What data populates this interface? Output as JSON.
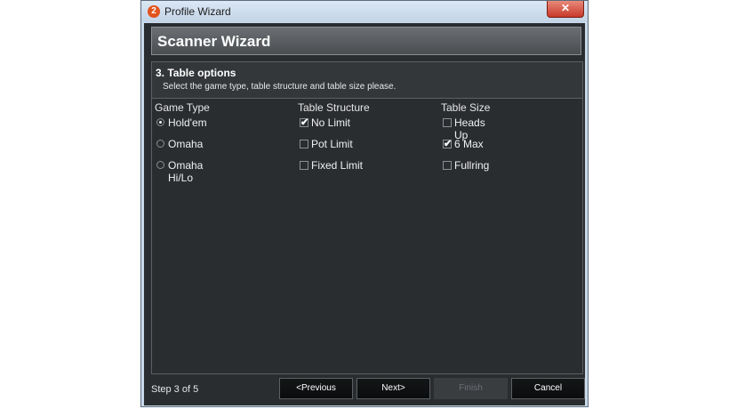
{
  "window": {
    "title": "Profile Wizard",
    "app_icon_text": "2",
    "close_symbol": "✕"
  },
  "wizard": {
    "header": "Scanner Wizard",
    "step": {
      "title": "3. Table options",
      "description": "Select the game type, table structure and table size please."
    },
    "columns": {
      "game_type": {
        "header": "Game Type",
        "options": [
          {
            "label": "Hold'em",
            "selected": true
          },
          {
            "label": "Omaha",
            "selected": false
          },
          {
            "label": "Omaha Hi/Lo",
            "selected": false
          }
        ]
      },
      "table_structure": {
        "header": "Table Structure",
        "options": [
          {
            "label": "No Limit",
            "checked": true
          },
          {
            "label": "Pot Limit",
            "checked": false
          },
          {
            "label": "Fixed Limit",
            "checked": false
          }
        ]
      },
      "table_size": {
        "header": "Table Size",
        "options": [
          {
            "label": "Heads Up",
            "checked": false
          },
          {
            "label": "6 Max",
            "checked": true
          },
          {
            "label": "Fullring",
            "checked": false
          }
        ]
      }
    },
    "footer": {
      "step_indicator": "Step 3 of 5",
      "previous_label": "<Previous",
      "next_label": "Next>",
      "finish_label": "Finish",
      "cancel_label": "Cancel"
    },
    "check_mark": "✔"
  }
}
